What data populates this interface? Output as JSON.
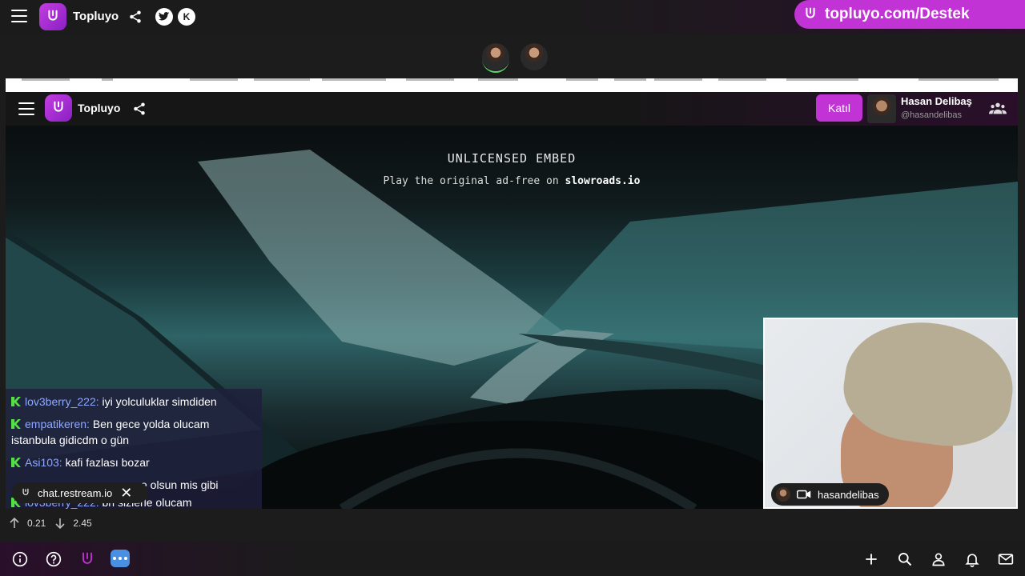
{
  "topbar": {
    "brand": "Topluyo",
    "support_link": "topluyo.com/Destek",
    "twitter_label": "",
    "k_label": "K"
  },
  "embed": {
    "brand": "Topluyo",
    "join_button": "Katıl",
    "user_name": "Hasan Delibaş",
    "user_handle": "@hasandelibas",
    "overlay_title": "UNLICENSED EMBED",
    "overlay_prefix": "Play the original ad-free on ",
    "overlay_site": "slowroads.io"
  },
  "chat": {
    "messages": [
      {
        "nick": "lov3berry_222:",
        "text": " iyi yolculuklar simdiden"
      },
      {
        "nick": "empatikeren:",
        "text": " Ben gece yolda olucam istanbula gidicdm o gün"
      },
      {
        "nick": "Asi103:",
        "text": " kafi fazlası bozar"
      },
      {
        "nick": "",
        "text": "e olsun mis gibi"
      },
      {
        "nick": "lov3berry_222:",
        "text": " bn sizlerle olucam"
      }
    ],
    "toast_text": "chat.restream.io"
  },
  "webcam": {
    "username": "hasandelibas"
  },
  "stats": {
    "up": "0.21",
    "down": "2.45"
  },
  "colors": {
    "accent": "#c233d6",
    "chat_nick": "#8fa8ff",
    "kick_green": "#53e042"
  }
}
